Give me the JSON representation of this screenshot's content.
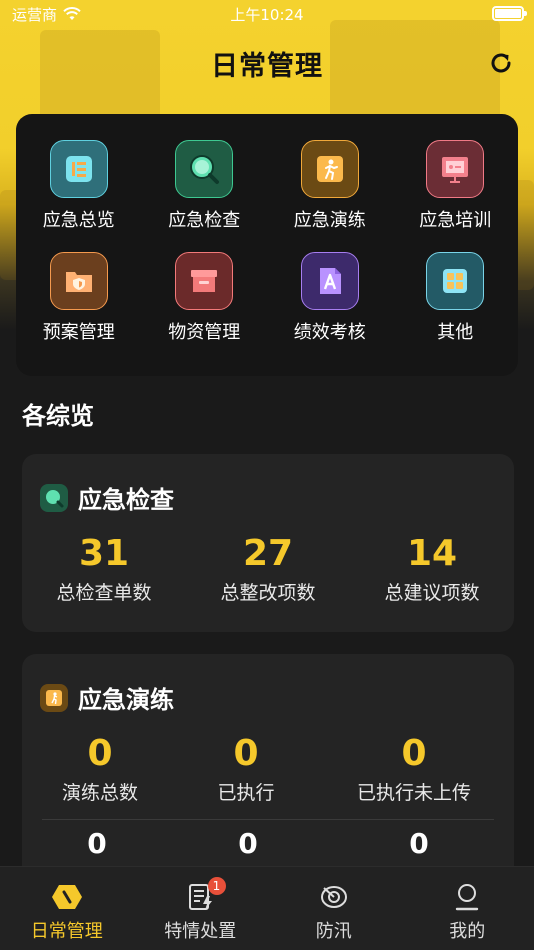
{
  "status_bar": {
    "carrier": "运营商",
    "time": "上午10:24"
  },
  "header": {
    "title": "日常管理",
    "refresh_icon": "refresh-icon"
  },
  "menu": {
    "items": [
      {
        "label": "应急总览",
        "icon": "overview-icon",
        "color": "#4fc6d6"
      },
      {
        "label": "应急检查",
        "icon": "magnifier-icon",
        "color": "#3ec891"
      },
      {
        "label": "应急演练",
        "icon": "running-man-icon",
        "color": "#f0a83a"
      },
      {
        "label": "应急培训",
        "icon": "presentation-icon",
        "color": "#f07a86"
      },
      {
        "label": "预案管理",
        "icon": "shield-folder-icon",
        "color": "#f59a4e"
      },
      {
        "label": "物资管理",
        "icon": "box-icon",
        "color": "#f37a7a"
      },
      {
        "label": "绩效考核",
        "icon": "document-a-icon",
        "color": "#a77ef0"
      },
      {
        "label": "其他",
        "icon": "grid-icon",
        "color": "#7ad4e8"
      }
    ]
  },
  "overview": {
    "title": "各综览"
  },
  "inspection": {
    "title": "应急检查",
    "stats": [
      {
        "value": "31",
        "label": "总检查单数"
      },
      {
        "value": "27",
        "label": "总整改项数"
      },
      {
        "value": "14",
        "label": "总建议项数"
      }
    ]
  },
  "drill": {
    "title": "应急演练",
    "stats": [
      {
        "value": "0",
        "label": "演练总数"
      },
      {
        "value": "0",
        "label": "已执行"
      },
      {
        "value": "0",
        "label": "已执行未上传"
      }
    ],
    "stats2": [
      {
        "value": "0"
      },
      {
        "value": "0"
      },
      {
        "value": "0"
      }
    ]
  },
  "tabbar": {
    "tabs": [
      {
        "label": "日常管理",
        "icon": "daily-management-icon",
        "active": true
      },
      {
        "label": "特情处置",
        "icon": "special-handling-icon",
        "badge": "1"
      },
      {
        "label": "防汛",
        "icon": "flood-control-icon"
      },
      {
        "label": "我的",
        "icon": "profile-icon"
      }
    ]
  },
  "colors": {
    "accent": "#f5c82b",
    "header_bg": "#f4d22e",
    "card_bg": "#242424"
  }
}
